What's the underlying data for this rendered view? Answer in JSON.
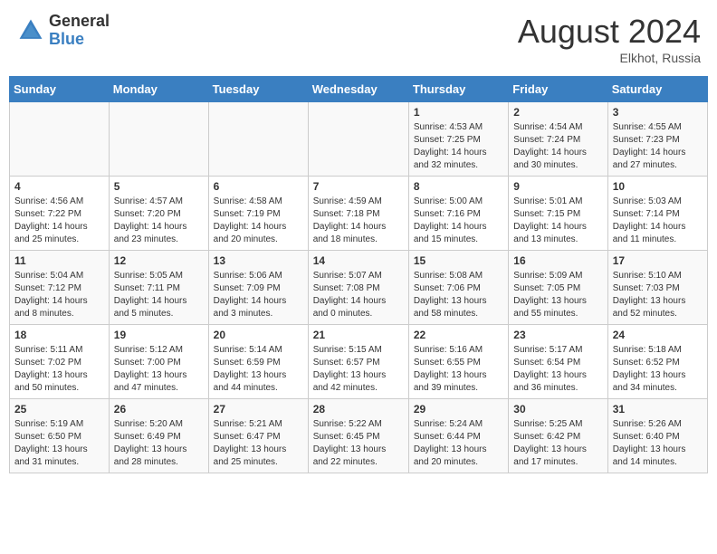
{
  "logo": {
    "general": "General",
    "blue": "Blue"
  },
  "title": "August 2024",
  "location": "Elkhot, Russia",
  "days_of_week": [
    "Sunday",
    "Monday",
    "Tuesday",
    "Wednesday",
    "Thursday",
    "Friday",
    "Saturday"
  ],
  "weeks": [
    [
      {
        "num": "",
        "info": ""
      },
      {
        "num": "",
        "info": ""
      },
      {
        "num": "",
        "info": ""
      },
      {
        "num": "",
        "info": ""
      },
      {
        "num": "1",
        "info": "Sunrise: 4:53 AM\nSunset: 7:25 PM\nDaylight: 14 hours\nand 32 minutes."
      },
      {
        "num": "2",
        "info": "Sunrise: 4:54 AM\nSunset: 7:24 PM\nDaylight: 14 hours\nand 30 minutes."
      },
      {
        "num": "3",
        "info": "Sunrise: 4:55 AM\nSunset: 7:23 PM\nDaylight: 14 hours\nand 27 minutes."
      }
    ],
    [
      {
        "num": "4",
        "info": "Sunrise: 4:56 AM\nSunset: 7:22 PM\nDaylight: 14 hours\nand 25 minutes."
      },
      {
        "num": "5",
        "info": "Sunrise: 4:57 AM\nSunset: 7:20 PM\nDaylight: 14 hours\nand 23 minutes."
      },
      {
        "num": "6",
        "info": "Sunrise: 4:58 AM\nSunset: 7:19 PM\nDaylight: 14 hours\nand 20 minutes."
      },
      {
        "num": "7",
        "info": "Sunrise: 4:59 AM\nSunset: 7:18 PM\nDaylight: 14 hours\nand 18 minutes."
      },
      {
        "num": "8",
        "info": "Sunrise: 5:00 AM\nSunset: 7:16 PM\nDaylight: 14 hours\nand 15 minutes."
      },
      {
        "num": "9",
        "info": "Sunrise: 5:01 AM\nSunset: 7:15 PM\nDaylight: 14 hours\nand 13 minutes."
      },
      {
        "num": "10",
        "info": "Sunrise: 5:03 AM\nSunset: 7:14 PM\nDaylight: 14 hours\nand 11 minutes."
      }
    ],
    [
      {
        "num": "11",
        "info": "Sunrise: 5:04 AM\nSunset: 7:12 PM\nDaylight: 14 hours\nand 8 minutes."
      },
      {
        "num": "12",
        "info": "Sunrise: 5:05 AM\nSunset: 7:11 PM\nDaylight: 14 hours\nand 5 minutes."
      },
      {
        "num": "13",
        "info": "Sunrise: 5:06 AM\nSunset: 7:09 PM\nDaylight: 14 hours\nand 3 minutes."
      },
      {
        "num": "14",
        "info": "Sunrise: 5:07 AM\nSunset: 7:08 PM\nDaylight: 14 hours\nand 0 minutes."
      },
      {
        "num": "15",
        "info": "Sunrise: 5:08 AM\nSunset: 7:06 PM\nDaylight: 13 hours\nand 58 minutes."
      },
      {
        "num": "16",
        "info": "Sunrise: 5:09 AM\nSunset: 7:05 PM\nDaylight: 13 hours\nand 55 minutes."
      },
      {
        "num": "17",
        "info": "Sunrise: 5:10 AM\nSunset: 7:03 PM\nDaylight: 13 hours\nand 52 minutes."
      }
    ],
    [
      {
        "num": "18",
        "info": "Sunrise: 5:11 AM\nSunset: 7:02 PM\nDaylight: 13 hours\nand 50 minutes."
      },
      {
        "num": "19",
        "info": "Sunrise: 5:12 AM\nSunset: 7:00 PM\nDaylight: 13 hours\nand 47 minutes."
      },
      {
        "num": "20",
        "info": "Sunrise: 5:14 AM\nSunset: 6:59 PM\nDaylight: 13 hours\nand 44 minutes."
      },
      {
        "num": "21",
        "info": "Sunrise: 5:15 AM\nSunset: 6:57 PM\nDaylight: 13 hours\nand 42 minutes."
      },
      {
        "num": "22",
        "info": "Sunrise: 5:16 AM\nSunset: 6:55 PM\nDaylight: 13 hours\nand 39 minutes."
      },
      {
        "num": "23",
        "info": "Sunrise: 5:17 AM\nSunset: 6:54 PM\nDaylight: 13 hours\nand 36 minutes."
      },
      {
        "num": "24",
        "info": "Sunrise: 5:18 AM\nSunset: 6:52 PM\nDaylight: 13 hours\nand 34 minutes."
      }
    ],
    [
      {
        "num": "25",
        "info": "Sunrise: 5:19 AM\nSunset: 6:50 PM\nDaylight: 13 hours\nand 31 minutes."
      },
      {
        "num": "26",
        "info": "Sunrise: 5:20 AM\nSunset: 6:49 PM\nDaylight: 13 hours\nand 28 minutes."
      },
      {
        "num": "27",
        "info": "Sunrise: 5:21 AM\nSunset: 6:47 PM\nDaylight: 13 hours\nand 25 minutes."
      },
      {
        "num": "28",
        "info": "Sunrise: 5:22 AM\nSunset: 6:45 PM\nDaylight: 13 hours\nand 22 minutes."
      },
      {
        "num": "29",
        "info": "Sunrise: 5:24 AM\nSunset: 6:44 PM\nDaylight: 13 hours\nand 20 minutes."
      },
      {
        "num": "30",
        "info": "Sunrise: 5:25 AM\nSunset: 6:42 PM\nDaylight: 13 hours\nand 17 minutes."
      },
      {
        "num": "31",
        "info": "Sunrise: 5:26 AM\nSunset: 6:40 PM\nDaylight: 13 hours\nand 14 minutes."
      }
    ]
  ]
}
